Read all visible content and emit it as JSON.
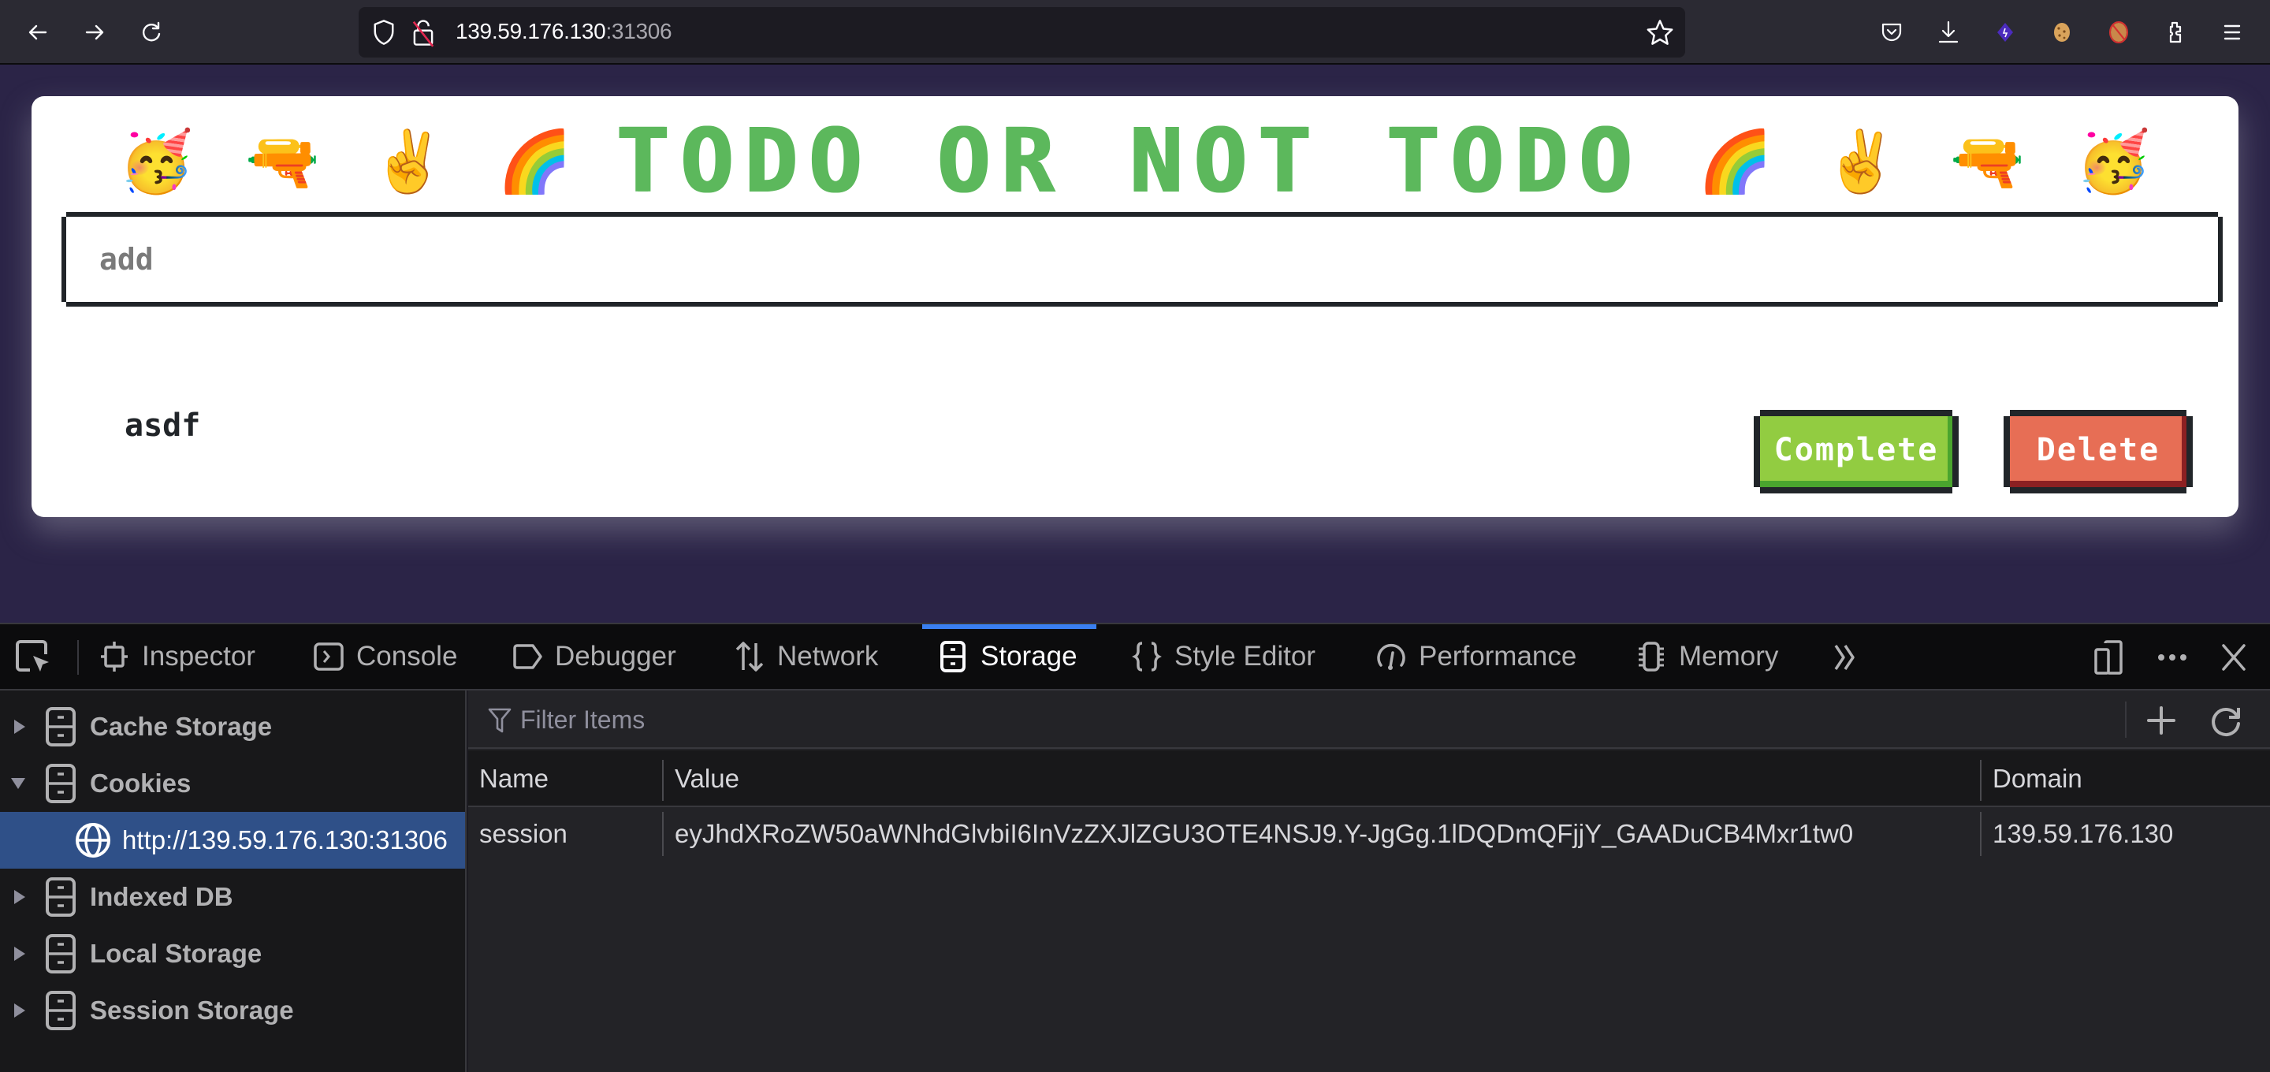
{
  "browser": {
    "url_host": "139.59.176.130",
    "url_port": ":31306",
    "nav": {
      "back": "back-icon",
      "forward": "forward-icon",
      "reload": "reload-icon"
    },
    "toolbar_icons": [
      "pocket-icon",
      "download-icon",
      "extension-purple-icon",
      "cookie-icon",
      "cookie-blocked-icon",
      "extensions-icon",
      "menu-icon"
    ]
  },
  "app": {
    "title": "TODO OR NOT TODO",
    "emojis_left": [
      "🥳",
      "🔫",
      "✌️",
      "🌈"
    ],
    "emojis_right": [
      "🌈",
      "✌️",
      "🔫",
      "🥳"
    ],
    "input_placeholder": "add",
    "input_value": "",
    "todos": [
      {
        "text": "asdf",
        "complete_label": "Complete",
        "delete_label": "Delete"
      }
    ],
    "colors": {
      "title": "#5cb85c",
      "complete": "#92cc41",
      "delete": "#e76e55",
      "background": "#2b2447"
    }
  },
  "devtools": {
    "tabs": [
      {
        "label": "Inspector",
        "icon": "inspector-icon"
      },
      {
        "label": "Console",
        "icon": "console-icon"
      },
      {
        "label": "Debugger",
        "icon": "debugger-icon"
      },
      {
        "label": "Network",
        "icon": "network-icon"
      },
      {
        "label": "Storage",
        "icon": "storage-icon",
        "active": true
      },
      {
        "label": "Style Editor",
        "icon": "style-editor-icon"
      },
      {
        "label": "Performance",
        "icon": "performance-icon"
      },
      {
        "label": "Memory",
        "icon": "memory-icon"
      }
    ],
    "sidebar": [
      {
        "label": "Cache Storage",
        "expanded": false
      },
      {
        "label": "Cookies",
        "expanded": true,
        "children": [
          {
            "label": "http://139.59.176.130:31306",
            "selected": true
          }
        ]
      },
      {
        "label": "Indexed DB",
        "expanded": false
      },
      {
        "label": "Local Storage",
        "expanded": false
      },
      {
        "label": "Session Storage",
        "expanded": false
      }
    ],
    "filter_placeholder": "Filter Items",
    "table": {
      "columns": [
        "Name",
        "Value",
        "Domain"
      ],
      "rows": [
        {
          "name": "session",
          "value": "eyJhdXRoZW50aWNhdGlvbiI6InVzZXJlZGU3OTE4NSJ9.Y-JgGg.1lDQDmQFjjY_GAADuCB4Mxr1tw0",
          "domain": "139.59.176.130"
        }
      ]
    }
  }
}
